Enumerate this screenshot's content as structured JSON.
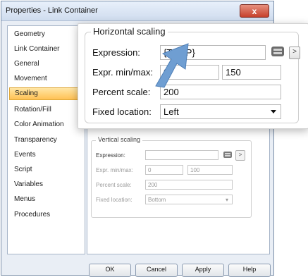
{
  "window": {
    "title": "Properties - Link Container"
  },
  "sidebar": {
    "items": [
      {
        "label": "Geometry"
      },
      {
        "label": "Link Container"
      },
      {
        "label": "General"
      },
      {
        "label": "Movement"
      },
      {
        "label": "Scaling"
      },
      {
        "label": "Rotation/Fill"
      },
      {
        "label": "Color Animation"
      },
      {
        "label": "Transparency"
      },
      {
        "label": "Events"
      },
      {
        "label": "Script"
      },
      {
        "label": "Variables"
      },
      {
        "label": "Menus"
      },
      {
        "label": "Procedures"
      }
    ],
    "selected": "Scaling"
  },
  "horizontal_scaling": {
    "legend": "Horizontal scaling",
    "expression_label": "Expression:",
    "expression_value": "{TEMP}",
    "minmax_label": "Expr. min/max:",
    "min_value": "0",
    "max_value": "150",
    "percent_label": "Percent scale:",
    "percent_value": "200",
    "fixed_label": "Fixed location:",
    "fixed_value": "Left",
    "arrow_button": ">"
  },
  "vertical_scaling": {
    "legend": "Vertical scaling",
    "expression_label": "Expression:",
    "expression_value": "",
    "minmax_label": "Expr. min/max:",
    "min_value": "0",
    "max_value": "100",
    "percent_label": "Percent scale:",
    "percent_value": "200",
    "fixed_label": "Fixed location:",
    "fixed_value": "Bottom",
    "arrow_button": ">"
  },
  "buttons": {
    "ok": "OK",
    "cancel": "Cancel",
    "apply": "Apply",
    "help": "Help",
    "close_glyph": "x"
  },
  "colors": {
    "selected_item": "#ffc154",
    "close_button": "#c6402b",
    "callout_arrow": "#6f9ed2"
  }
}
